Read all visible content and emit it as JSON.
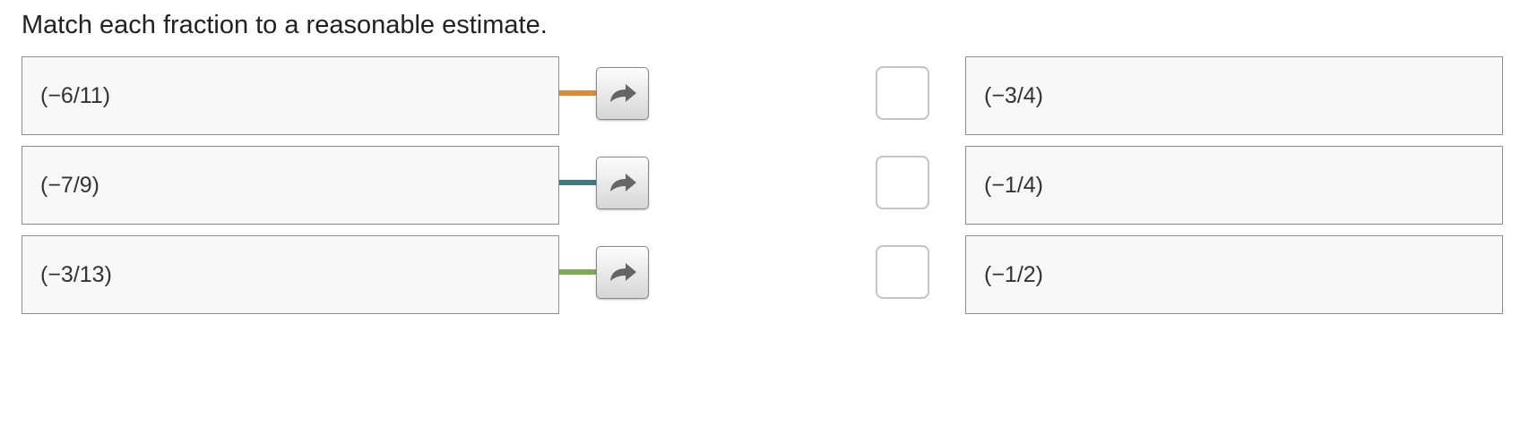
{
  "prompt": "Match each fraction to a reasonable estimate.",
  "left_items": [
    {
      "label": "(−6/11)",
      "connector_color": "#e08a35"
    },
    {
      "label": "(−7/9)",
      "connector_color": "#3d7a82"
    },
    {
      "label": "(−3/13)",
      "connector_color": "#7fab57"
    }
  ],
  "right_items": [
    {
      "label": "(−3/4)"
    },
    {
      "label": "(−1/4)"
    },
    {
      "label": "(−1/2)"
    }
  ],
  "icons": {
    "move_button_icon": "curved-arrow-right-icon"
  },
  "colors": {
    "box_border": "#8c8c8c",
    "box_background": "#f8f8f8",
    "target_border": "#c4c4c4",
    "arrow_fill": "#666666"
  }
}
